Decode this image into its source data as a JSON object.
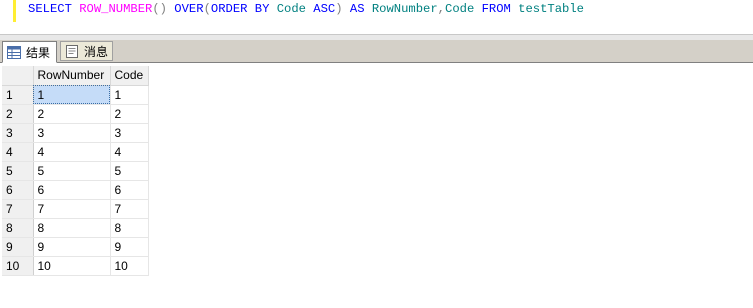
{
  "editor": {
    "tokens": [
      {
        "text": "SELECT ",
        "cls": "kw"
      },
      {
        "text": "ROW_NUMBER",
        "cls": "fn"
      },
      {
        "text": "() ",
        "cls": "gr"
      },
      {
        "text": "OVER",
        "cls": "kw"
      },
      {
        "text": "(",
        "cls": "gr"
      },
      {
        "text": "ORDER BY ",
        "cls": "kw"
      },
      {
        "text": "Code ",
        "cls": "id"
      },
      {
        "text": "ASC",
        "cls": "kw"
      },
      {
        "text": ") ",
        "cls": "gr"
      },
      {
        "text": "AS ",
        "cls": "kw"
      },
      {
        "text": "RowNumber",
        "cls": "id"
      },
      {
        "text": ",",
        "cls": "gr"
      },
      {
        "text": "Code ",
        "cls": "id"
      },
      {
        "text": "FROM ",
        "cls": "kw"
      },
      {
        "text": "testTable",
        "cls": "id"
      }
    ]
  },
  "tabs": {
    "results": "结果",
    "messages": "消息"
  },
  "grid": {
    "columns": [
      "RowNumber",
      "Code"
    ],
    "rows": [
      {
        "n": "1",
        "cells": [
          "1",
          "1"
        ]
      },
      {
        "n": "2",
        "cells": [
          "2",
          "2"
        ]
      },
      {
        "n": "3",
        "cells": [
          "3",
          "3"
        ]
      },
      {
        "n": "4",
        "cells": [
          "4",
          "4"
        ]
      },
      {
        "n": "5",
        "cells": [
          "5",
          "5"
        ]
      },
      {
        "n": "6",
        "cells": [
          "6",
          "6"
        ]
      },
      {
        "n": "7",
        "cells": [
          "7",
          "7"
        ]
      },
      {
        "n": "8",
        "cells": [
          "8",
          "8"
        ]
      },
      {
        "n": "9",
        "cells": [
          "9",
          "9"
        ]
      },
      {
        "n": "10",
        "cells": [
          "10",
          "10"
        ]
      }
    ]
  },
  "colors": {
    "keyword": "#0000ff",
    "function": "#ff00ff",
    "identifier": "#008080",
    "selection": "#c5dcf8"
  }
}
